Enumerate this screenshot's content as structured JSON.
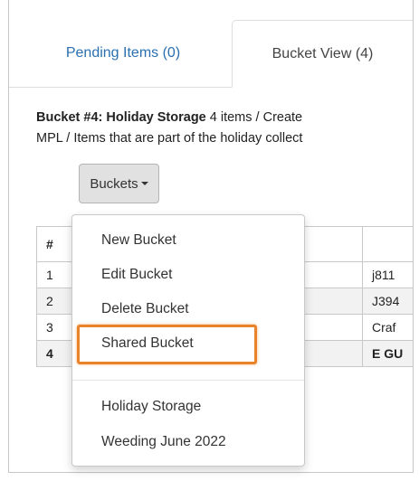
{
  "tabs": [
    {
      "label": "Pending Items (0)"
    },
    {
      "label": "Bucket View (4)"
    }
  ],
  "bucket_info": {
    "name_prefix": "Bucket #4: Holiday Storage",
    "line1_rest": " 4 items / Create",
    "line2": "MPL / Items that are part of the holiday collect"
  },
  "buckets_button": {
    "label": "Buckets"
  },
  "table": {
    "headers": [
      "#",
      "",
      ""
    ],
    "rows": [
      {
        "num": "1",
        "mid": "",
        "right": "j811"
      },
      {
        "num": "2",
        "mid": "",
        "right": "J394"
      },
      {
        "num": "3",
        "mid": "",
        "right": "Craf"
      },
      {
        "num": "4",
        "mid": "",
        "right": "E GU"
      }
    ]
  },
  "dropdown": {
    "items": [
      "New Bucket",
      "Edit Bucket",
      "Delete Bucket",
      "Shared Bucket"
    ],
    "buckets": [
      "Holiday Storage",
      "Weeding June 2022"
    ]
  },
  "colors": {
    "highlight": "#e8832a",
    "tab_link": "#2a6fb0"
  }
}
